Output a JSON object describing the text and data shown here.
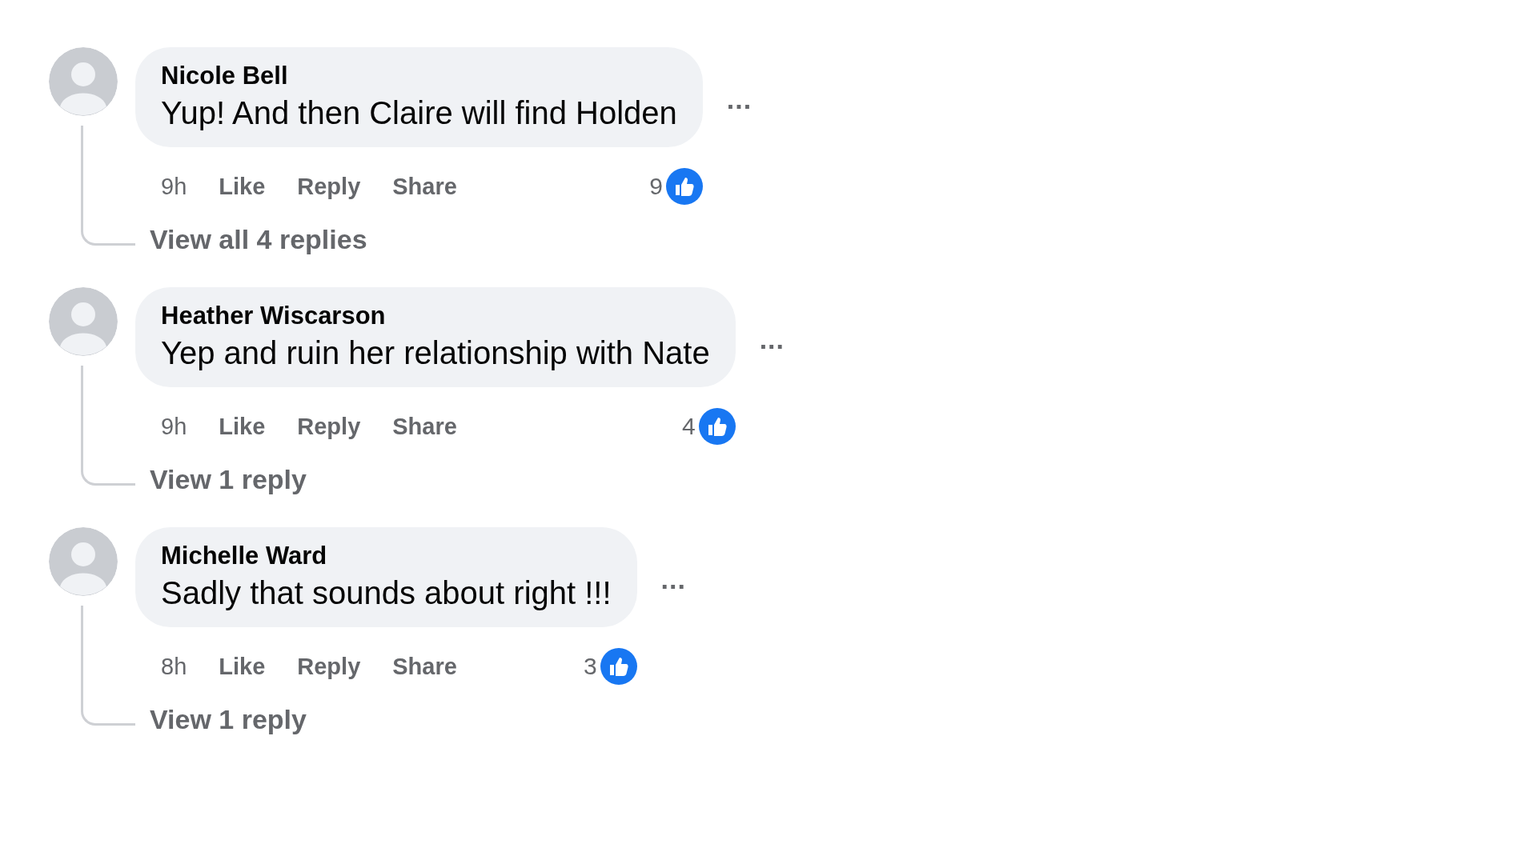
{
  "comments": [
    {
      "author": "Nicole Bell",
      "text": "Yup! And then Claire will find Holden",
      "more": "...",
      "time": "9h",
      "actions": [
        "Like",
        "Reply",
        "Share"
      ],
      "reaction_count": "9",
      "replies_link": "View all 4 replies"
    },
    {
      "author": "Heather Wiscarson",
      "text": "Yep and ruin her relationship with Nate",
      "more": "...",
      "time": "9h",
      "actions": [
        "Like",
        "Reply",
        "Share"
      ],
      "reaction_count": "4",
      "replies_link": "View 1 reply"
    },
    {
      "author": "Michelle Ward",
      "text": "Sadly that sounds about right !!!",
      "more": "...",
      "time": "8h",
      "actions": [
        "Like",
        "Reply",
        "Share"
      ],
      "reaction_count": "3",
      "replies_link": "View 1 reply"
    }
  ]
}
